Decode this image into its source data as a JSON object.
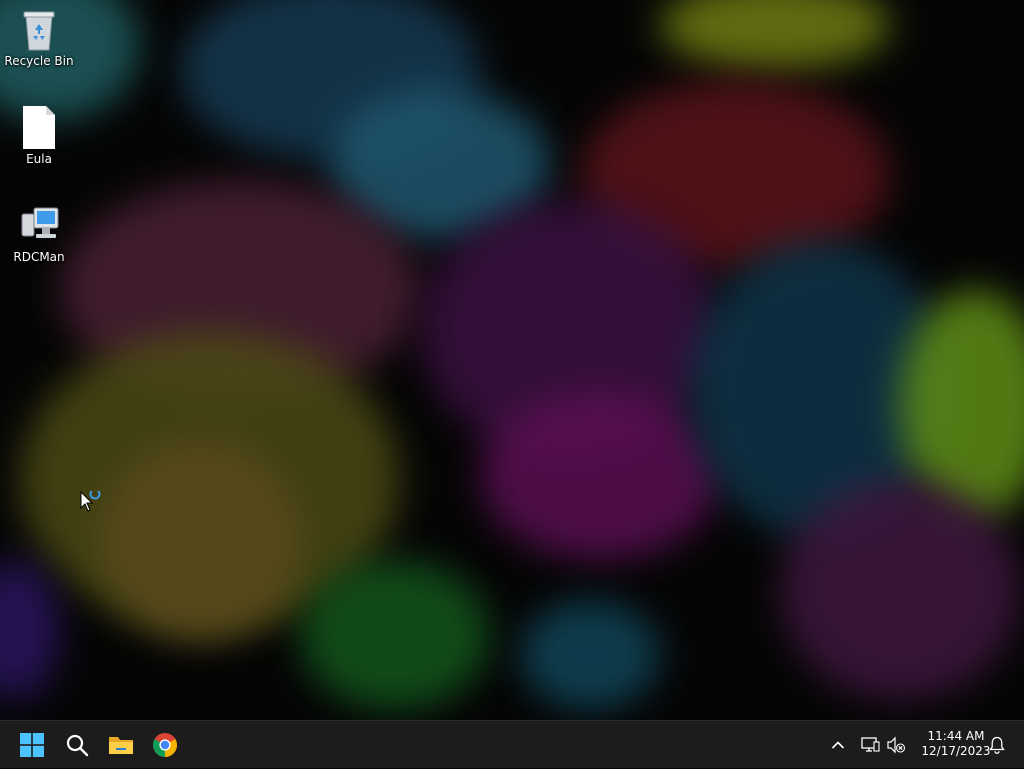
{
  "desktop": {
    "icons": [
      {
        "label": "Recycle Bin",
        "icon": "recycle-bin-icon"
      },
      {
        "label": "Eula",
        "icon": "document-icon"
      },
      {
        "label": "RDCMan",
        "icon": "rdcman-icon"
      }
    ]
  },
  "taskbar": {
    "pinned": [
      {
        "name": "start",
        "icon": "windows-logo-icon"
      },
      {
        "name": "search",
        "icon": "search-icon"
      },
      {
        "name": "file-explorer",
        "icon": "folder-icon"
      },
      {
        "name": "chrome",
        "icon": "chrome-icon"
      }
    ],
    "tray": {
      "overflow_icon": "chevron-up-icon",
      "network_icon": "network-icon",
      "volume_icon": "speaker-muted-icon",
      "notification_icon": "bell-icon"
    },
    "clock": {
      "time": "11:44 AM",
      "date": "12/17/2023"
    }
  },
  "colors": {
    "accent": "#0078d4",
    "taskbar_bg": "#1c1c1c",
    "text": "#ffffff"
  }
}
